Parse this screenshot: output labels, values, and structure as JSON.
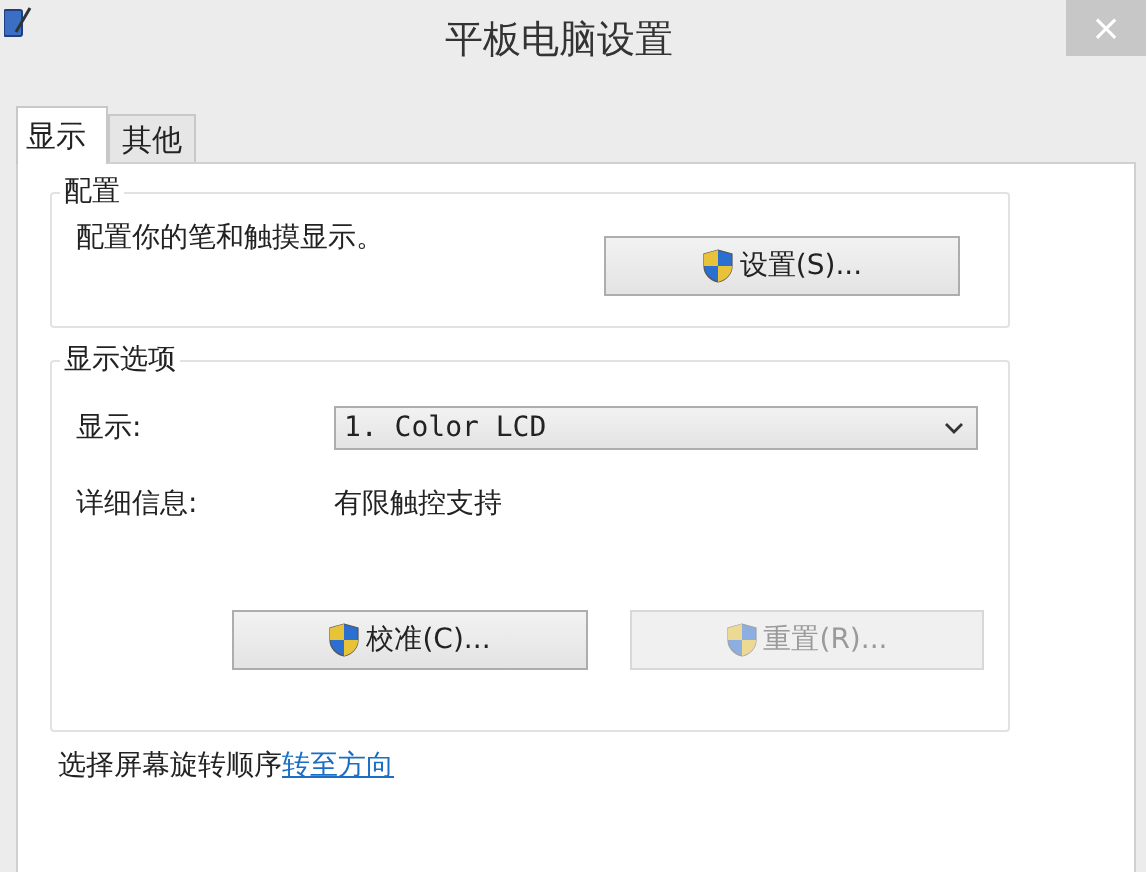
{
  "window": {
    "title": "平板电脑设置",
    "close": "×"
  },
  "tabs": [
    {
      "label": "显示",
      "selected": true
    },
    {
      "label": "其他",
      "selected": false
    }
  ],
  "config_group": {
    "title": "配置",
    "description": "配置你的笔和触摸显示。",
    "button": {
      "label": "设置(S)...",
      "disabled": false
    }
  },
  "display_group": {
    "title": "显示选项",
    "display_label": "显示:",
    "display_value": "1. Color LCD",
    "details_label": "详细信息:",
    "details_value": "有限触控支持",
    "buttons": [
      {
        "label": "校准(C)...",
        "disabled": false
      },
      {
        "label": "重置(R)...",
        "disabled": true
      }
    ]
  },
  "footer": {
    "text": "选择屏幕旋转顺序",
    "link": "转至方向"
  }
}
